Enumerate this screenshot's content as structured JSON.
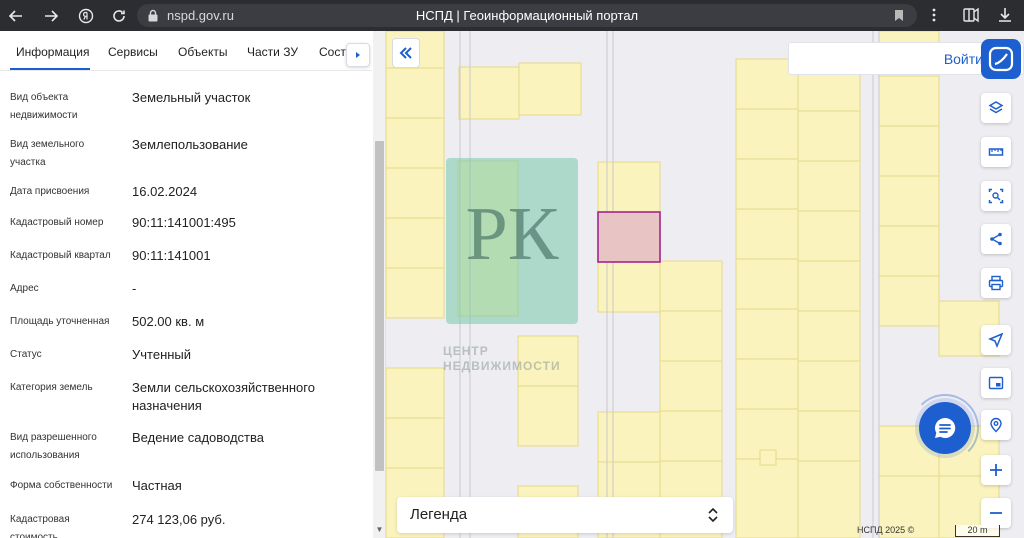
{
  "browser": {
    "url": "nspd.gov.ru",
    "tab_title": "НСПД | Геоинформационный портал"
  },
  "panel": {
    "tabs": [
      {
        "label": "Информация"
      },
      {
        "label": "Сервисы"
      },
      {
        "label": "Объекты"
      },
      {
        "label": "Части ЗУ"
      },
      {
        "label": "Соста"
      }
    ],
    "rows": [
      {
        "label": "Вид объекта недвижимости",
        "value": "Земельный участок"
      },
      {
        "label": "Вид земельного участка",
        "value": "Землепользование"
      },
      {
        "label": "Дата присвоения",
        "value": "16.02.2024"
      },
      {
        "label": "Кадастровый номер",
        "value": "90:11:141001:495"
      },
      {
        "label": "Кадастровый квартал",
        "value": "90:11:141001"
      },
      {
        "label": "Адрес",
        "value": "-"
      },
      {
        "label": "Площадь уточненная",
        "value": "502.00 кв. м"
      },
      {
        "label": "Статус",
        "value": "Учтенный"
      },
      {
        "label": "Категория земель",
        "value": "Земли сельскохозяйственного назначения"
      },
      {
        "label": "Вид разрешенного использования",
        "value": "Ведение садоводства"
      },
      {
        "label": "Форма собственности",
        "value": "Частная"
      },
      {
        "label": "Кадастровая стоимость",
        "value": "274 123,06 руб."
      }
    ]
  },
  "map": {
    "login_label": "Войти",
    "legend_label": "Легенда",
    "copyright": "НСПД 2025 ©",
    "scale_label": "20 m",
    "watermark": {
      "logo_text": "РК",
      "line1": "ЦЕНТР",
      "line2": "НЕДВИЖИМОСТИ"
    },
    "tools": [
      "layers-icon",
      "ruler-icon",
      "area-select-icon",
      "share-icon",
      "print-icon",
      "locate-icon",
      "minimap-icon",
      "geo-search-icon",
      "zoom-in-icon",
      "zoom-out-icon"
    ]
  },
  "colors": {
    "accent": "#1d5fcf",
    "parcel_fill": "#fbf3bd",
    "parcel_stroke": "#e6d98a",
    "selected_fill": "#e9c4c4",
    "selected_stroke": "#a3248f"
  }
}
